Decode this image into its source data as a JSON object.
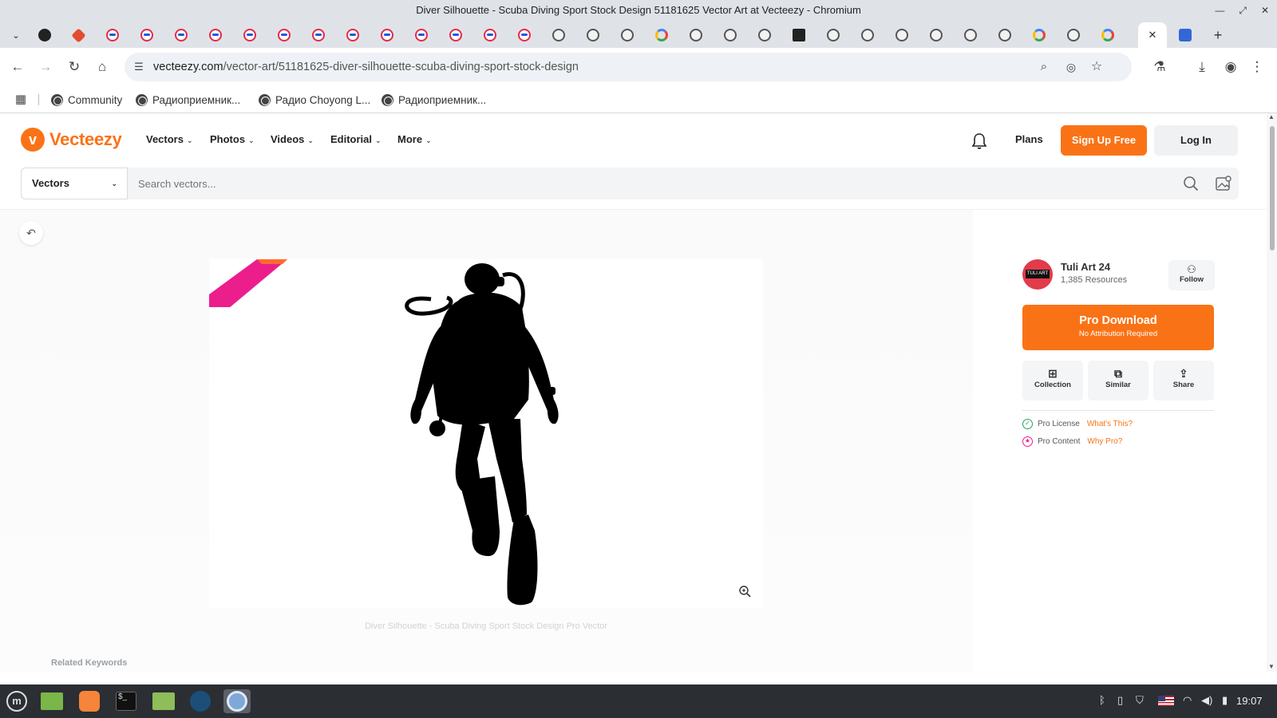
{
  "window": {
    "title": "Diver Silhouette - Scuba Diving Sport Stock Design 51181625 Vector Art at Vecteezy - Chromium"
  },
  "browser": {
    "url_domain": "vecteezy.com",
    "url_path": "/vector-art/51181625-diver-silhouette-scuba-diving-sport-stock-design",
    "bookmarks": [
      {
        "label": "Community"
      },
      {
        "label": "Радиоприемник..."
      },
      {
        "label": "Радио Choyong L..."
      },
      {
        "label": "Радиоприемник..."
      }
    ]
  },
  "site": {
    "logo": "Vecteezy",
    "nav": [
      {
        "label": "Vectors"
      },
      {
        "label": "Photos"
      },
      {
        "label": "Videos"
      },
      {
        "label": "Editorial"
      },
      {
        "label": "More"
      }
    ],
    "plans": "Plans",
    "signup": "Sign Up Free",
    "login": "Log In",
    "search": {
      "category": "Vectors",
      "placeholder": "Search vectors..."
    }
  },
  "asset": {
    "badge": "Pro",
    "caption": "Diver Silhouette - Scuba Diving Sport Stock Design Pro Vector",
    "related_keywords": "Related Keywords"
  },
  "author": {
    "avatar_text": "TULI ART",
    "name": "Tuli Art 24",
    "resources": "1,385 Resources",
    "follow": "Follow"
  },
  "download": {
    "title": "Pro Download",
    "subtitle": "No Attribution Required"
  },
  "actions": [
    {
      "label": "Collection"
    },
    {
      "label": "Similar"
    },
    {
      "label": "Share"
    }
  ],
  "license": [
    {
      "label": "Pro License",
      "link": "What's This?"
    },
    {
      "label": "Pro Content",
      "link": "Why Pro?"
    }
  ],
  "taskbar": {
    "clock": "19:07"
  },
  "colors": {
    "brand_orange": "#f97316",
    "pro_pink": "#ec1e8c"
  }
}
